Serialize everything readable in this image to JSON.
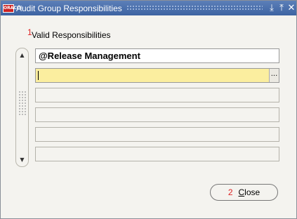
{
  "window": {
    "title": "Audit Group Responsibilities",
    "icon_text": "ORACLE"
  },
  "titlebar_buttons": {
    "minimize": "⤓",
    "maximize": "⤒",
    "close": "✕"
  },
  "form": {
    "section_number": "1",
    "section_label": "Valid Responsibilities",
    "rows": [
      {
        "value": "@Release Management",
        "state": "filled"
      },
      {
        "value": "",
        "state": "active"
      },
      {
        "value": "",
        "state": "empty"
      },
      {
        "value": "",
        "state": "empty"
      },
      {
        "value": "",
        "state": "empty"
      },
      {
        "value": "",
        "state": "empty"
      }
    ],
    "lov_button": "..."
  },
  "scrollbar": {
    "up_arrow": "▲",
    "down_arrow": "▼"
  },
  "close_button": {
    "number": "2",
    "label_first": "C",
    "label_rest": "lose"
  }
}
